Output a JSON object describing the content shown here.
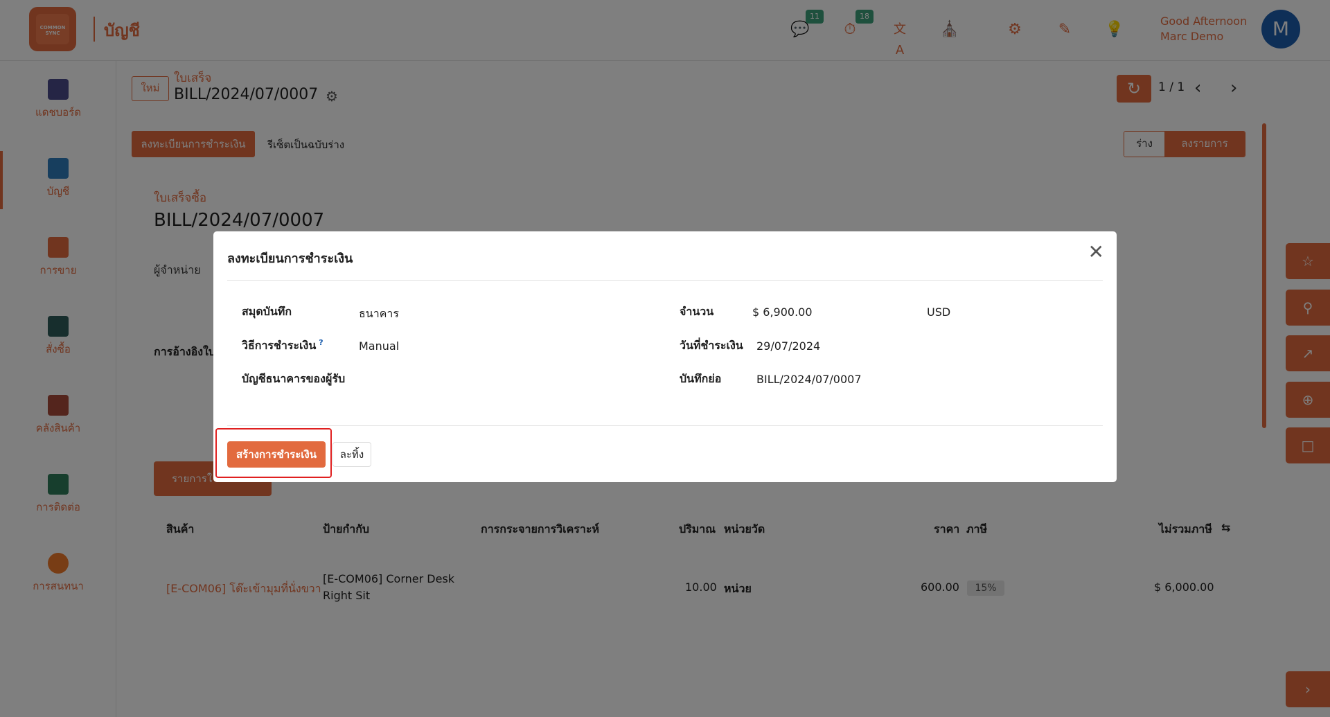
{
  "header": {
    "logo_text": "COMMON SYNC",
    "app_title": "บัญชี",
    "chat_badge": "11",
    "timer_badge": "18",
    "greeting": "Good Afternoon",
    "user_name": "Marc Demo",
    "avatar_letter": "M"
  },
  "sidebar": {
    "items": [
      {
        "label": "แดชบอร์ด",
        "color": "#4a4a8a"
      },
      {
        "label": "บัญชี",
        "color": "#2e7dbd"
      },
      {
        "label": "การขาย",
        "color": "#e26a3e"
      },
      {
        "label": "สั่งซื้อ",
        "color": "#2f5d5a"
      },
      {
        "label": "คลังสินค้า",
        "color": "#a84a3a"
      },
      {
        "label": "การติดต่อ",
        "color": "#2e7d5a"
      },
      {
        "label": "การสนทนา",
        "color": "#f07a2a"
      }
    ]
  },
  "breadcrumb": {
    "new_label": "ใหม่",
    "parent": "ใบเสร็จ",
    "current": "BILL/2024/07/0007"
  },
  "pager": {
    "text": "1 / 1"
  },
  "actions": {
    "register_payment": "ลงทะเบียนการชำระเงิน",
    "reset_draft": "รีเซ็ตเป็นฉบับร่าง",
    "status_draft": "ร่าง",
    "status_posted": "ลงรายการ"
  },
  "form": {
    "doc_type": "ใบเสร็จซื้อ",
    "doc_number": "BILL/2024/07/0007",
    "vendor_label": "ผู้จำหน่าย",
    "reference_label": "การอ้างอิงใบ",
    "lines_tab": "รายการใ"
  },
  "table": {
    "headers": {
      "product": "สินค้า",
      "label": "ป้ายกำกับ",
      "analytic": "การกระจายการวิเคราะห์",
      "quantity": "ปริมาณ",
      "uom": "หน่วยวัด",
      "price": "ราคา",
      "taxes": "ภาษี",
      "subtotal": "ไม่รวมภาษี"
    },
    "rows": [
      {
        "product": "[E-COM06] โต๊ะเข้ามุมที่นั่งขวา",
        "label_line1": "[E-COM06] Corner Desk",
        "label_line2": "Right Sit",
        "quantity": "10.00",
        "uom": "หน่วย",
        "price": "600.00",
        "tax": "15%",
        "subtotal": "$ 6,000.00"
      }
    ]
  },
  "modal": {
    "title": "ลงทะเบียนการชำระเงิน",
    "journal_label": "สมุดบันทึก",
    "journal_value": "ธนาคาร",
    "method_label": "วิธีการชำระเงิน",
    "method_help": "?",
    "method_value": "Manual",
    "recipient_bank_label": "บัญชีธนาคารของผู้รับ",
    "amount_label": "จำนวน",
    "amount_value": "$ 6,900.00",
    "currency_value": "USD",
    "date_label": "วันที่ชำระเงิน",
    "date_value": "29/07/2024",
    "memo_label": "บันทึกย่อ",
    "memo_value": "BILL/2024/07/0007",
    "create_button": "สร้างการชำระเงิน",
    "discard_button": "ละทิ้ง"
  }
}
